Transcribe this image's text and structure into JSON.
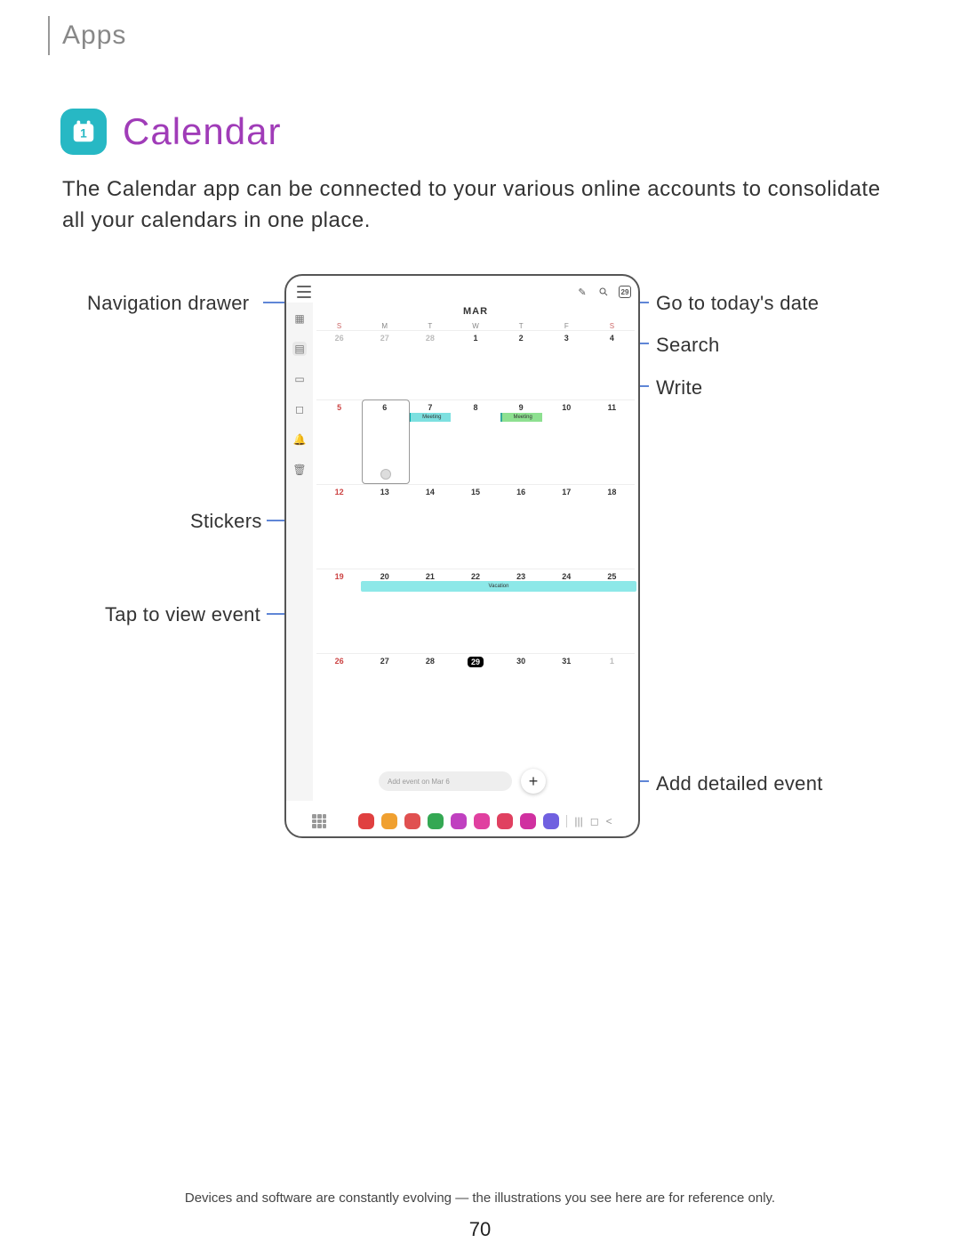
{
  "header": {
    "section": "Apps"
  },
  "title": "Calendar",
  "description": "The Calendar app can be connected to your various online accounts to consolidate all your calendars in one place.",
  "callouts": {
    "nav_drawer": "Navigation drawer",
    "stickers": "Stickers",
    "tap_event": "Tap to view event",
    "today": "Go to today's date",
    "search": "Search",
    "write": "Write",
    "add_event": "Add detailed event"
  },
  "calendar": {
    "month": "MAR",
    "today_badge": "29",
    "dow": [
      "S",
      "M",
      "T",
      "W",
      "T",
      "F",
      "S"
    ],
    "weeks": [
      [
        {
          "n": "26",
          "gray": true,
          "sun": true
        },
        {
          "n": "27",
          "gray": true
        },
        {
          "n": "28",
          "gray": true
        },
        {
          "n": "1"
        },
        {
          "n": "2"
        },
        {
          "n": "3"
        },
        {
          "n": "4"
        }
      ],
      [
        {
          "n": "5",
          "sun": true
        },
        {
          "n": "6",
          "sel": true
        },
        {
          "n": "7",
          "ev": "Meeting"
        },
        {
          "n": "8"
        },
        {
          "n": "9",
          "ev": "Meeting",
          "green": true
        },
        {
          "n": "10"
        },
        {
          "n": "11"
        }
      ],
      [
        {
          "n": "12",
          "sun": true
        },
        {
          "n": "13"
        },
        {
          "n": "14"
        },
        {
          "n": "15"
        },
        {
          "n": "16"
        },
        {
          "n": "17"
        },
        {
          "n": "18"
        }
      ],
      [
        {
          "n": "19",
          "sun": true
        },
        {
          "n": "20"
        },
        {
          "n": "21"
        },
        {
          "n": "22"
        },
        {
          "n": "23"
        },
        {
          "n": "24"
        },
        {
          "n": "25"
        }
      ],
      [
        {
          "n": "26",
          "sun": true
        },
        {
          "n": "27"
        },
        {
          "n": "28"
        },
        {
          "n": "29",
          "today": true
        },
        {
          "n": "30"
        },
        {
          "n": "31"
        },
        {
          "n": "1",
          "gray": true
        }
      ]
    ],
    "vacation_label": "Vacation",
    "add_placeholder": "Add event on Mar 6"
  },
  "dock_colors": [
    "#e04040",
    "#f0a030",
    "#e05050",
    "#34a853",
    "#c040c0",
    "#e040a0",
    "#e04060",
    "#d030a0",
    "#7060e0"
  ],
  "footer": "Devices and software are constantly evolving — the illustrations you see here are for reference only.",
  "page_number": "70"
}
